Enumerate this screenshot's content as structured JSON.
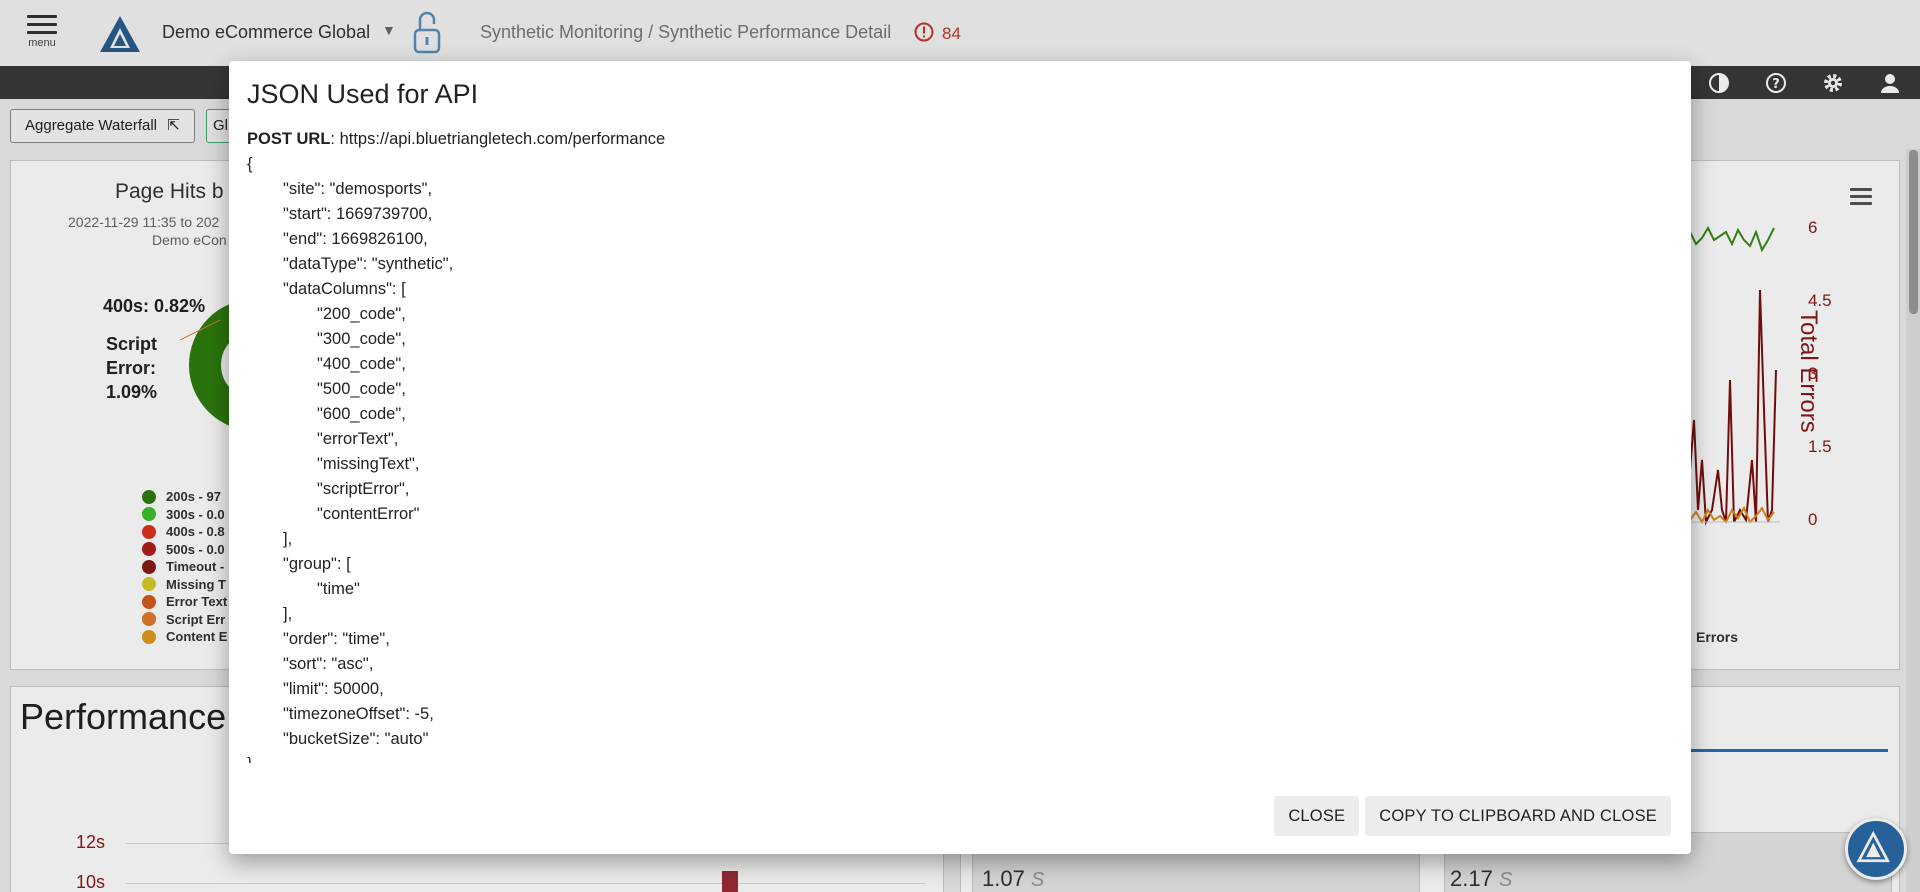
{
  "header": {
    "menu_label": "menu",
    "site_name": "Demo eCommerce Global",
    "breadcrumb": "Synthetic Monitoring / Synthetic Performance Detail",
    "alert_count": "84"
  },
  "toolbar": {
    "aggregate_waterfall": "Aggregate Waterfall",
    "gl_button": "Gl"
  },
  "chart": {
    "title": "Page Hits b",
    "subtitle": "2022-11-29 11:35 to 202",
    "subtitle2": "Demo eCon",
    "label_400": "400s: 0.82%",
    "label_script_1": "Script",
    "label_script_2": "Error:",
    "label_script_3": "1.09%",
    "legend": [
      {
        "label": "200s - 97",
        "color": "#2e7d0e"
      },
      {
        "label": "300s - 0.0",
        "color": "#3fbf2a"
      },
      {
        "label": "400s - 0.8",
        "color": "#e0301e"
      },
      {
        "label": "500s - 0.0",
        "color": "#b01e1e"
      },
      {
        "label": "Timeout -",
        "color": "#8b1a1a"
      },
      {
        "label": "Missing T",
        "color": "#d4cc28"
      },
      {
        "label": "Error Text",
        "color": "#d65a1e"
      },
      {
        "label": "Script Err",
        "color": "#e07a2a"
      },
      {
        "label": "Content E",
        "color": "#e09a1e"
      }
    ],
    "right_axis": [
      "6",
      "4.5",
      "3",
      "1.5",
      "0"
    ],
    "right_axis_title": "Total Errors",
    "errors_label": "Errors"
  },
  "performance": {
    "title": "Performance",
    "y_labels": [
      "12s",
      "10s"
    ],
    "metric1_value": "1.07",
    "metric1_unit": "S",
    "metric2_value": "2.17",
    "metric2_unit": "S"
  },
  "modal": {
    "title": "JSON Used for API",
    "post_label": "POST URL",
    "post_url": ": https://api.bluetriangletech.com/performance",
    "json_lines": [
      {
        "text": "{",
        "indent": 0
      },
      {
        "text": "\"site\": \"demosports\",",
        "indent": 1
      },
      {
        "text": "\"start\": 1669739700,",
        "indent": 1
      },
      {
        "text": "\"end\": 1669826100,",
        "indent": 1
      },
      {
        "text": "\"dataType\": \"synthetic\",",
        "indent": 1
      },
      {
        "text": "\"dataColumns\": [",
        "indent": 1
      },
      {
        "text": "\"200_code\",",
        "indent": 2
      },
      {
        "text": "\"300_code\",",
        "indent": 2
      },
      {
        "text": "\"400_code\",",
        "indent": 2
      },
      {
        "text": "\"500_code\",",
        "indent": 2
      },
      {
        "text": "\"600_code\",",
        "indent": 2
      },
      {
        "text": "\"errorText\",",
        "indent": 2
      },
      {
        "text": "\"missingText\",",
        "indent": 2
      },
      {
        "text": "\"scriptError\",",
        "indent": 2
      },
      {
        "text": "\"contentError\"",
        "indent": 2
      },
      {
        "text": "],",
        "indent": 1
      },
      {
        "text": "\"group\": [",
        "indent": 1
      },
      {
        "text": "\"time\"",
        "indent": 2
      },
      {
        "text": "],",
        "indent": 1
      },
      {
        "text": "\"order\": \"time\",",
        "indent": 1
      },
      {
        "text": "\"sort\": \"asc\",",
        "indent": 1
      },
      {
        "text": "\"limit\": 50000,",
        "indent": 1
      },
      {
        "text": "\"timezoneOffset\": -5,",
        "indent": 1
      },
      {
        "text": "\"bucketSize\": \"auto\"",
        "indent": 1
      },
      {
        "text": "}",
        "indent": 0
      }
    ],
    "close_label": "CLOSE",
    "copy_label": "COPY TO CLIPBOARD AND CLOSE"
  }
}
